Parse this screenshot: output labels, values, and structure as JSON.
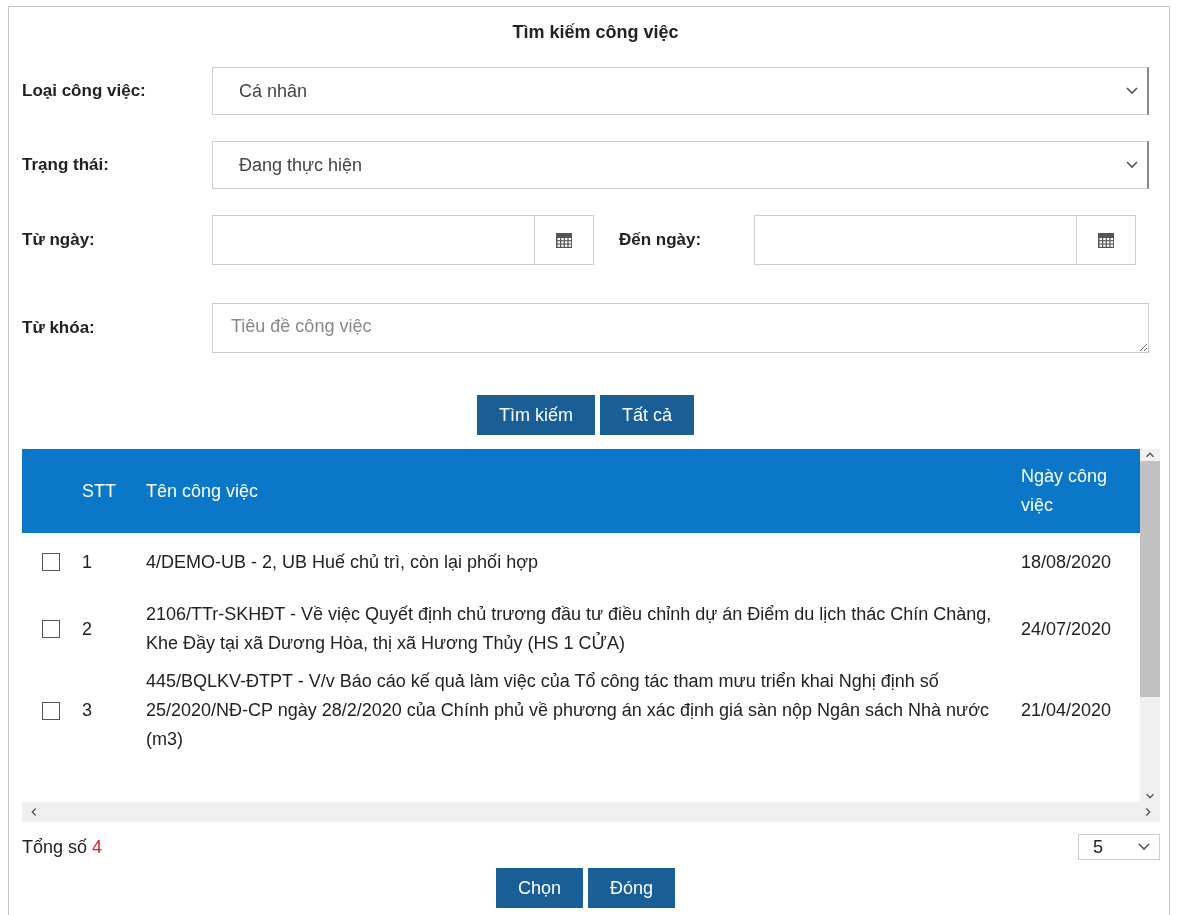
{
  "dialog": {
    "title": "Tìm kiếm công việc"
  },
  "filters": {
    "type": {
      "label": "Loại công việc:",
      "value": "Cá nhân"
    },
    "status": {
      "label": "Trạng thái:",
      "value": "Đang thực hiện"
    },
    "from_date": {
      "label": "Từ ngày:"
    },
    "to_date": {
      "label": "Đến ngày:"
    },
    "keyword": {
      "label": "Từ khóa:",
      "placeholder": "Tiêu đề công việc"
    }
  },
  "search_buttons": [
    "Tìm kiếm",
    "Tất cả"
  ],
  "table": {
    "columns": [
      "STT",
      "Tên công việc",
      "Ngày công việc"
    ],
    "rows": [
      {
        "checked": false,
        "stt": "1",
        "title": "4/DEMO-UB - 2, UB Huế chủ trì, còn lại phối hợp",
        "date": "18/08/2020"
      },
      {
        "checked": false,
        "stt": "2",
        "title": "2106/TTr-SKHĐT - Về việc Quyết định chủ trương đầu tư điều chỉnh dự án Điểm du lịch thác Chín Chàng, Khe Đầy tại xã Dương Hòa, thị xã Hương Thủy (HS 1 CỬA)",
        "date": "24/07/2020"
      },
      {
        "checked": false,
        "stt": "3",
        "title": "445/BQLKV-ĐTPT - V/v Báo cáo kế quả làm việc của Tổ công tác tham mưu triển khai Nghị định số 25/2020/NĐ-CP ngày 28/2/2020 của Chính phủ về phương án xác định giá sàn nộp Ngân sách Nhà nước (m3)",
        "date": "21/04/2020"
      }
    ]
  },
  "footer": {
    "total_label": "Tổng số",
    "total": "4",
    "page_size": "5"
  },
  "action_buttons": [
    "Chọn",
    "Đóng"
  ]
}
